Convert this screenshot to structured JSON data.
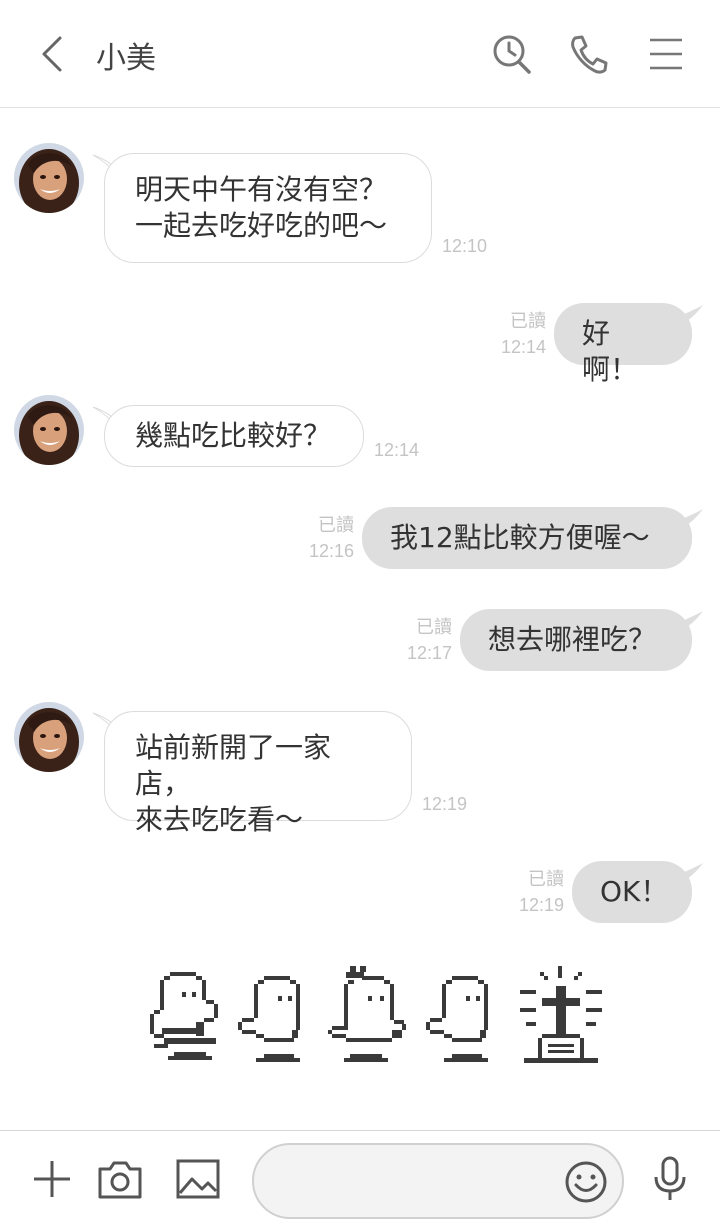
{
  "header": {
    "contact_name": "小美",
    "icons": [
      "back-chevron-icon",
      "search-history-icon",
      "phone-icon",
      "menu-icon"
    ]
  },
  "messages": [
    {
      "direction": "in",
      "text": "明天中午有沒有空？\n一起去吃好吃的吧～",
      "time": "12:10"
    },
    {
      "direction": "out",
      "text": "好啊！",
      "read": "已讀",
      "time": "12:14"
    },
    {
      "direction": "in",
      "text": "幾點吃比較好？",
      "time": "12:14"
    },
    {
      "direction": "out",
      "text": "我12點比較方便喔～",
      "read": "已讀",
      "time": "12:16"
    },
    {
      "direction": "out",
      "text": "想去哪裡吃？",
      "read": "已讀",
      "time": "12:17"
    },
    {
      "direction": "in",
      "text": "站前新開了一家店，\n來去吃吃看～",
      "time": "12:19"
    },
    {
      "direction": "out",
      "text": "OK！",
      "read": "已讀",
      "time": "12:19"
    }
  ],
  "sticker": {
    "name": "pixel-ghosts-sticker"
  },
  "footer": {
    "input_placeholder": "",
    "icons": [
      "plus-icon",
      "camera-icon",
      "image-icon",
      "emoji-icon",
      "microphone-icon"
    ]
  },
  "colors": {
    "outgoing_bubble": "#dedede",
    "incoming_bubble": "#ffffff",
    "timestamp": "#c4c4c4",
    "icon": "#777777"
  }
}
